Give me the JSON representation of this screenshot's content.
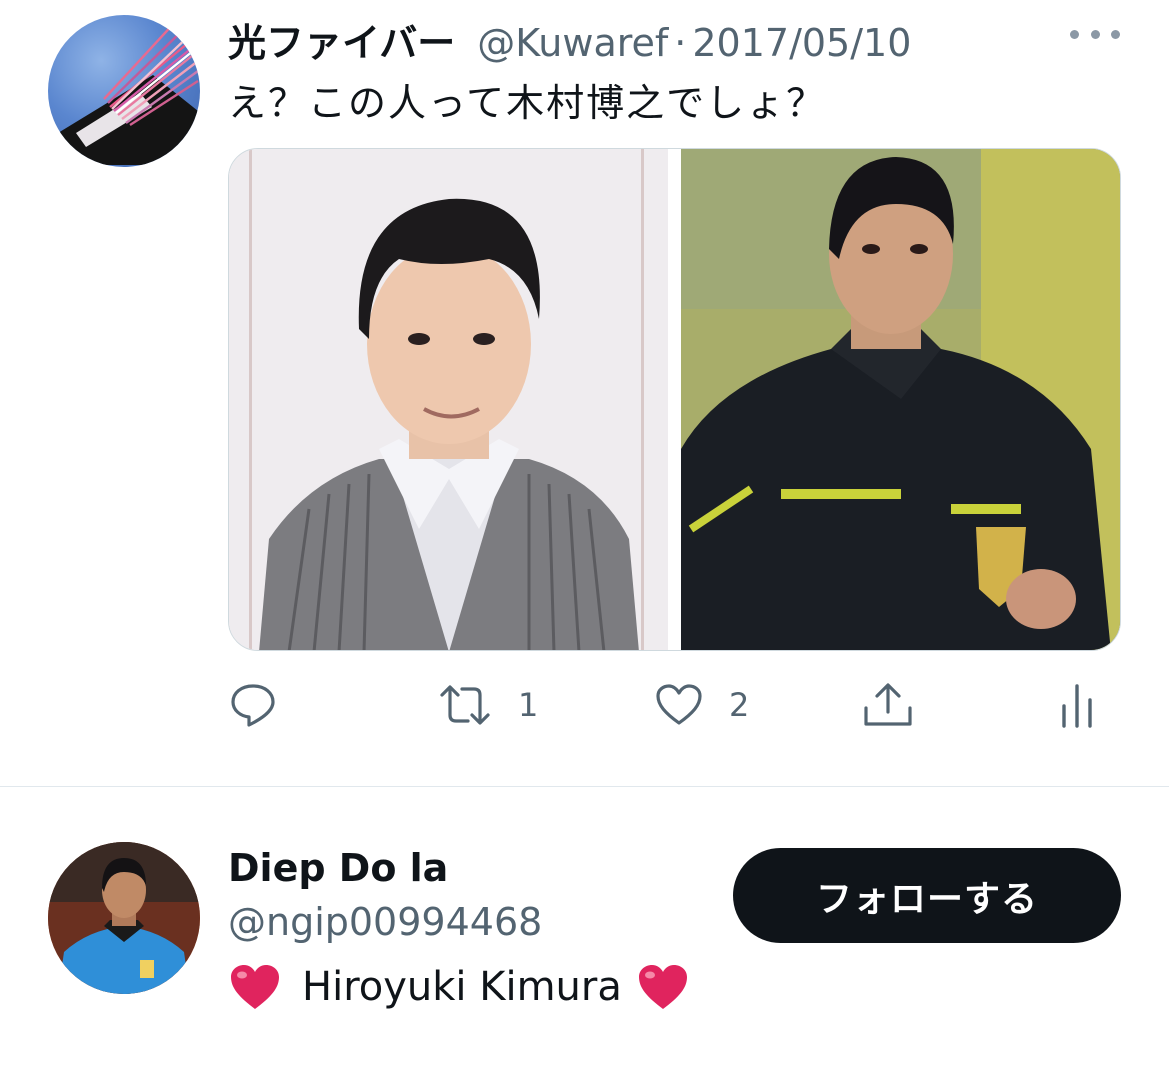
{
  "tweet": {
    "author": {
      "display_name": "光ファイバー",
      "handle": "@Kuwaref",
      "avatar": "fiber-optic-cable-image"
    },
    "date": "2017/05/10",
    "separator": "·",
    "text": "え？この人って木村博之でしょ？",
    "media": [
      {
        "description": "man-in-grey-striped-suit-photo"
      },
      {
        "description": "referee-in-black-kit-photo"
      }
    ],
    "actions": {
      "reply": {
        "icon": "reply-icon",
        "count": ""
      },
      "retweet": {
        "icon": "retweet-icon",
        "count": "1"
      },
      "like": {
        "icon": "heart-icon",
        "count": "2"
      },
      "share": {
        "icon": "share-icon"
      },
      "analytics": {
        "icon": "analytics-icon"
      }
    }
  },
  "user_card": {
    "display_name": "Diep Do la",
    "handle": "@ngip00994468",
    "bio": "Hiroyuki Kimura",
    "bio_emoji": "red-heart",
    "follow_label": "フォローする",
    "avatar": "referee-in-blue-kit-photo"
  },
  "colors": {
    "text_primary": "#0f1419",
    "text_secondary": "#536471",
    "divider": "#e1e8ed",
    "button_bg": "#0f1419",
    "button_text": "#ffffff",
    "heart": "#e0245e"
  }
}
